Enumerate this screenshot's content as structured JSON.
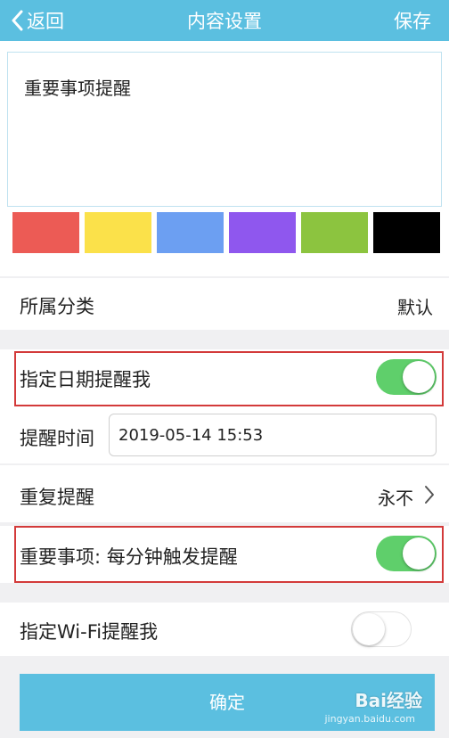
{
  "navbar": {
    "back_label": "返回",
    "title": "内容设置",
    "save_label": "保存"
  },
  "content": {
    "text": "重要事项提醒",
    "colors": [
      "#ec5b55",
      "#fbe14a",
      "#6c9ff2",
      "#8f57ee",
      "#8cc43f",
      "#000000"
    ]
  },
  "category": {
    "label": "所属分类",
    "value": "默认"
  },
  "date_reminder": {
    "label": "指定日期提醒我",
    "enabled": true
  },
  "reminder_time": {
    "label": "提醒时间",
    "value": "2019-05-14 15:53"
  },
  "repeat": {
    "label": "重复提醒",
    "value": "永不"
  },
  "important": {
    "label": "重要事项: 每分钟触发提醒",
    "enabled": true
  },
  "wifi_reminder": {
    "label": "指定Wi-Fi提醒我",
    "enabled": false
  },
  "confirm_label": "确定",
  "watermark": {
    "brand": "Bai经验",
    "url": "jingyan.baidu.com"
  }
}
